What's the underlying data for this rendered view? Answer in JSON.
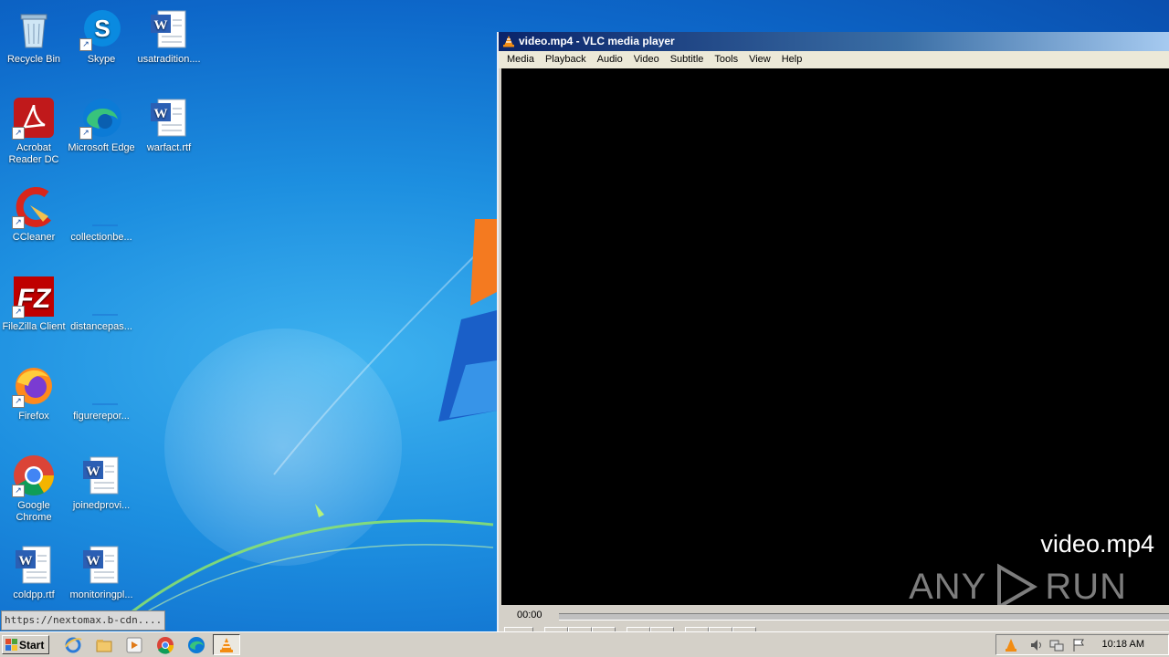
{
  "desktop": {
    "icons": [
      {
        "label": "Recycle Bin",
        "icon": "recycle-bin-icon"
      },
      {
        "label": "Skype",
        "icon": "skype-icon"
      },
      {
        "label": "usatradition....",
        "icon": "word-document-icon"
      },
      {
        "label": "Acrobat Reader DC",
        "icon": "acrobat-reader-icon"
      },
      {
        "label": "Microsoft Edge",
        "icon": "edge-icon"
      },
      {
        "label": "warfact.rtf",
        "icon": "word-document-icon"
      },
      {
        "label": "CCleaner",
        "icon": "ccleaner-icon"
      },
      {
        "label": "collectionbe...",
        "icon": "blank-file-icon"
      },
      {
        "label": "FileZilla Client",
        "icon": "filezilla-icon"
      },
      {
        "label": "distancepas...",
        "icon": "blank-file-icon"
      },
      {
        "label": "Firefox",
        "icon": "firefox-icon"
      },
      {
        "label": "figurerepor...",
        "icon": "blank-file-icon"
      },
      {
        "label": "Google Chrome",
        "icon": "chrome-icon"
      },
      {
        "label": "joinedprovi...",
        "icon": "word-document-icon"
      },
      {
        "label": "coldpp.rtf",
        "icon": "word-document-icon"
      },
      {
        "label": "monitoringpl...",
        "icon": "word-document-icon"
      }
    ]
  },
  "vlc": {
    "title": "video.mp4 - VLC media player",
    "menu": [
      "Media",
      "Playback",
      "Audio",
      "Video",
      "Subtitle",
      "Tools",
      "View",
      "Help"
    ],
    "video_caption": "video.mp4",
    "watermark_left": "ANY",
    "watermark_right": "RUN",
    "time_elapsed": "00:00"
  },
  "status_tooltip": "https://nextomax.b-cdn....",
  "taskbar": {
    "start_label": "Start",
    "pinned": [
      "internet-explorer-icon",
      "file-explorer-icon",
      "media-player-icon",
      "chrome-icon",
      "edge-icon",
      "vlc-icon"
    ],
    "tray_icons": [
      "vlc-icon",
      "volume-icon",
      "network-icon",
      "flag-icon"
    ],
    "clock": "10:18 AM"
  },
  "colors": {
    "vlc_orange": "#f28c12",
    "title_bar": "#0a246a",
    "taskbar": "#d4d0c8"
  }
}
